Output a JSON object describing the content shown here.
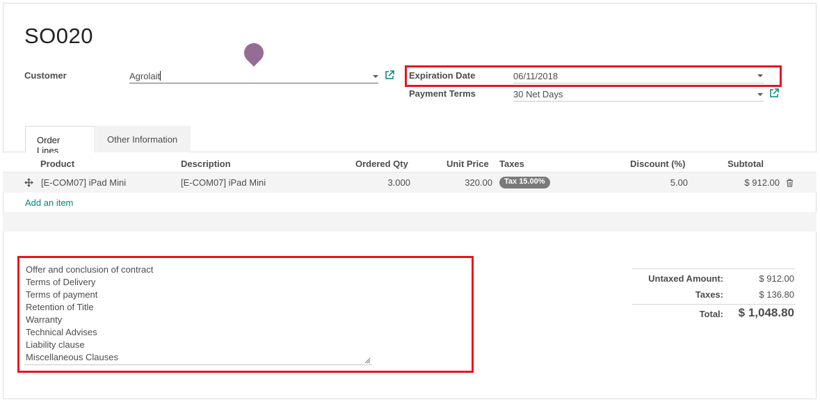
{
  "record": {
    "name": "SO020"
  },
  "customer": {
    "label": "Customer",
    "value": "Agrolait"
  },
  "expiration": {
    "label": "Expiration Date",
    "value": "06/11/2018"
  },
  "payment_terms": {
    "label": "Payment Terms",
    "value": "30 Net Days"
  },
  "tabs": [
    {
      "label": "Order Lines",
      "active": true
    },
    {
      "label": "Other Information",
      "active": false
    }
  ],
  "order_lines": {
    "headers": {
      "product": "Product",
      "description": "Description",
      "qty": "Ordered Qty",
      "unit_price": "Unit Price",
      "taxes": "Taxes",
      "discount": "Discount (%)",
      "subtotal": "Subtotal"
    },
    "rows": [
      {
        "product": "[E-COM07] iPad Mini",
        "description": "[E-COM07] iPad Mini",
        "qty": "3.000",
        "unit_price": "320.00",
        "tax": "Tax 15.00%",
        "discount": "5.00",
        "subtotal": "$ 912.00"
      }
    ],
    "add_item": "Add an item"
  },
  "notes": [
    "Offer and conclusion of contract",
    "Terms of Delivery",
    "Terms of payment",
    "Retention of Title",
    "Warranty",
    "Technical Advises",
    "Liability clause",
    "Miscellaneous Clauses"
  ],
  "totals": {
    "untaxed_label": "Untaxed Amount:",
    "untaxed_value": "$ 912.00",
    "taxes_label": "Taxes:",
    "taxes_value": "$ 136.80",
    "total_label": "Total:",
    "total_value": "$ 1,048.80"
  },
  "colors": {
    "accent": "#00857c",
    "highlight": "#e8141e",
    "badge": "#7a7a7a",
    "marker": "#8c5f8a"
  }
}
